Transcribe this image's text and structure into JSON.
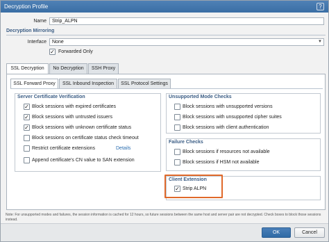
{
  "dialog": {
    "title": "Decryption Profile",
    "help_icon": "question-icon"
  },
  "form": {
    "name_label": "Name",
    "name_value": "Strip_ALPN",
    "mirroring_heading": "Decryption Mirroring",
    "interface_label": "Interface",
    "interface_value": "None",
    "forwarded_only_label": "Forwarded Only"
  },
  "tabs": [
    {
      "label": "SSL Decryption"
    },
    {
      "label": "No Decryption"
    },
    {
      "label": "SSH Proxy"
    }
  ],
  "subtabs": [
    {
      "label": "SSL Forward Proxy"
    },
    {
      "label": "SSL Inbound Inspection"
    },
    {
      "label": "SSL Protocol Settings"
    }
  ],
  "server_cert": {
    "title": "Server Certificate Verification",
    "items": [
      {
        "label": "Block sessions with expired certificates",
        "checked": true
      },
      {
        "label": "Block sessions with untrusted issuers",
        "checked": true
      },
      {
        "label": "Block sessions with unknown certificate status",
        "checked": true
      },
      {
        "label": "Block sessions on certificate status check timeout",
        "checked": false
      },
      {
        "label": "Restrict certificate extensions",
        "checked": false
      },
      {
        "label": "Append certificate's CN value to SAN extension",
        "checked": false
      }
    ],
    "details_link": "Details"
  },
  "unsupported": {
    "title": "Unsupported Mode Checks",
    "items": [
      {
        "label": "Block sessions with unsupported versions",
        "checked": false
      },
      {
        "label": "Block sessions with unsupported cipher suites",
        "checked": false
      },
      {
        "label": "Block sessions with client authentication",
        "checked": false
      }
    ]
  },
  "failure": {
    "title": "Failure Checks",
    "items": [
      {
        "label": "Block sessions if resources not available",
        "checked": false
      },
      {
        "label": "Block sessions if HSM not available",
        "checked": false
      }
    ]
  },
  "client_ext": {
    "title": "Client Extension",
    "items": [
      {
        "label": "Strip ALPN",
        "checked": true
      }
    ]
  },
  "footer": {
    "note": "Note: For unsupported modes and failures, the session information is cached for 12 hours, so future sessions between the same host and server pair are not decrypted. Check boxes to block those sessions instead.",
    "ok_label": "OK",
    "cancel_label": "Cancel"
  },
  "colors": {
    "titlebar": "#3a6ea5",
    "section_heading": "#3a5c84",
    "highlight": "#e0692a",
    "link": "#2a6db0"
  }
}
